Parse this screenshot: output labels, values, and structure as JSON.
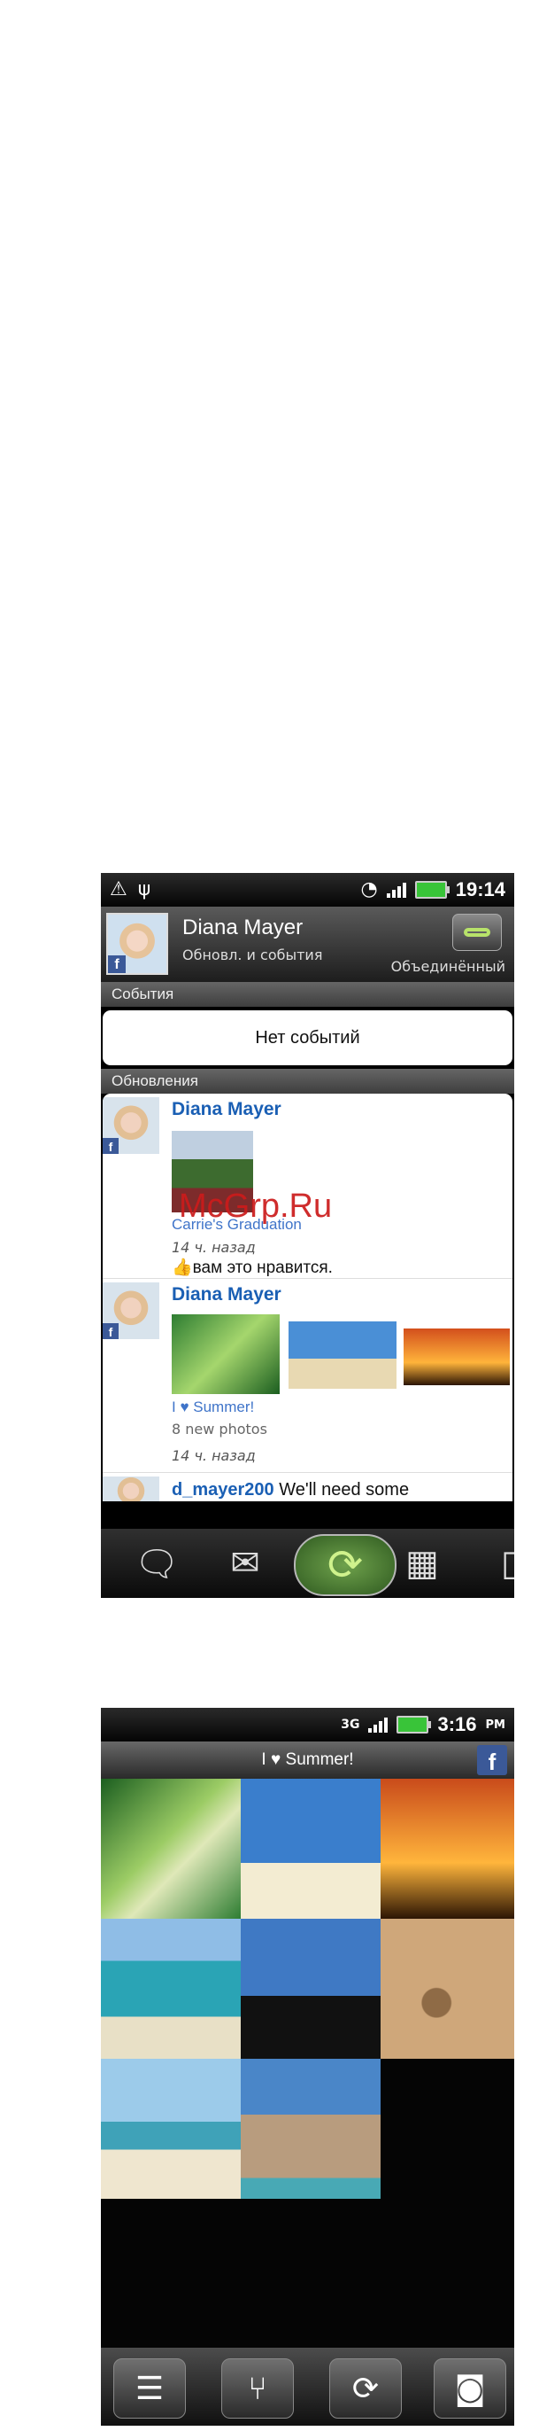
{
  "screen1": {
    "status": {
      "time": "19:14"
    },
    "profile": {
      "name": "Diana Mayer",
      "subtitle": "Обновл. и события",
      "linked_label": "Объединённый"
    },
    "events_header": "События",
    "no_events": "Нет событий",
    "updates_header": "Обновления",
    "posts": [
      {
        "author": "Diana Mayer",
        "caption": "Carrie's Graduation",
        "time": "14 ч. назад",
        "likes": "вам это нравится."
      },
      {
        "author": "Diana Mayer",
        "caption": "I ♥ Summer!",
        "meta": "8 new photos",
        "time": "14 ч. назад"
      },
      {
        "author": "d_mayer200",
        "text": "We'll need some"
      }
    ],
    "dock": [
      "message-compose-icon",
      "mail-icon",
      "refresh-icon",
      "gallery-icon",
      "document-icon"
    ]
  },
  "watermark": "McGrp.Ru",
  "screen2": {
    "status": {
      "net": "3G",
      "time": "3:16",
      "ampm": "PM"
    },
    "title": "I ♥ Summer!",
    "bottom": [
      "menu-icon",
      "share-icon",
      "refresh-icon",
      "camera-icon"
    ]
  },
  "colors": {
    "facebook": "#3b5998",
    "link_blue": "#1a5fb4",
    "accent_green": "#b8e36a"
  }
}
